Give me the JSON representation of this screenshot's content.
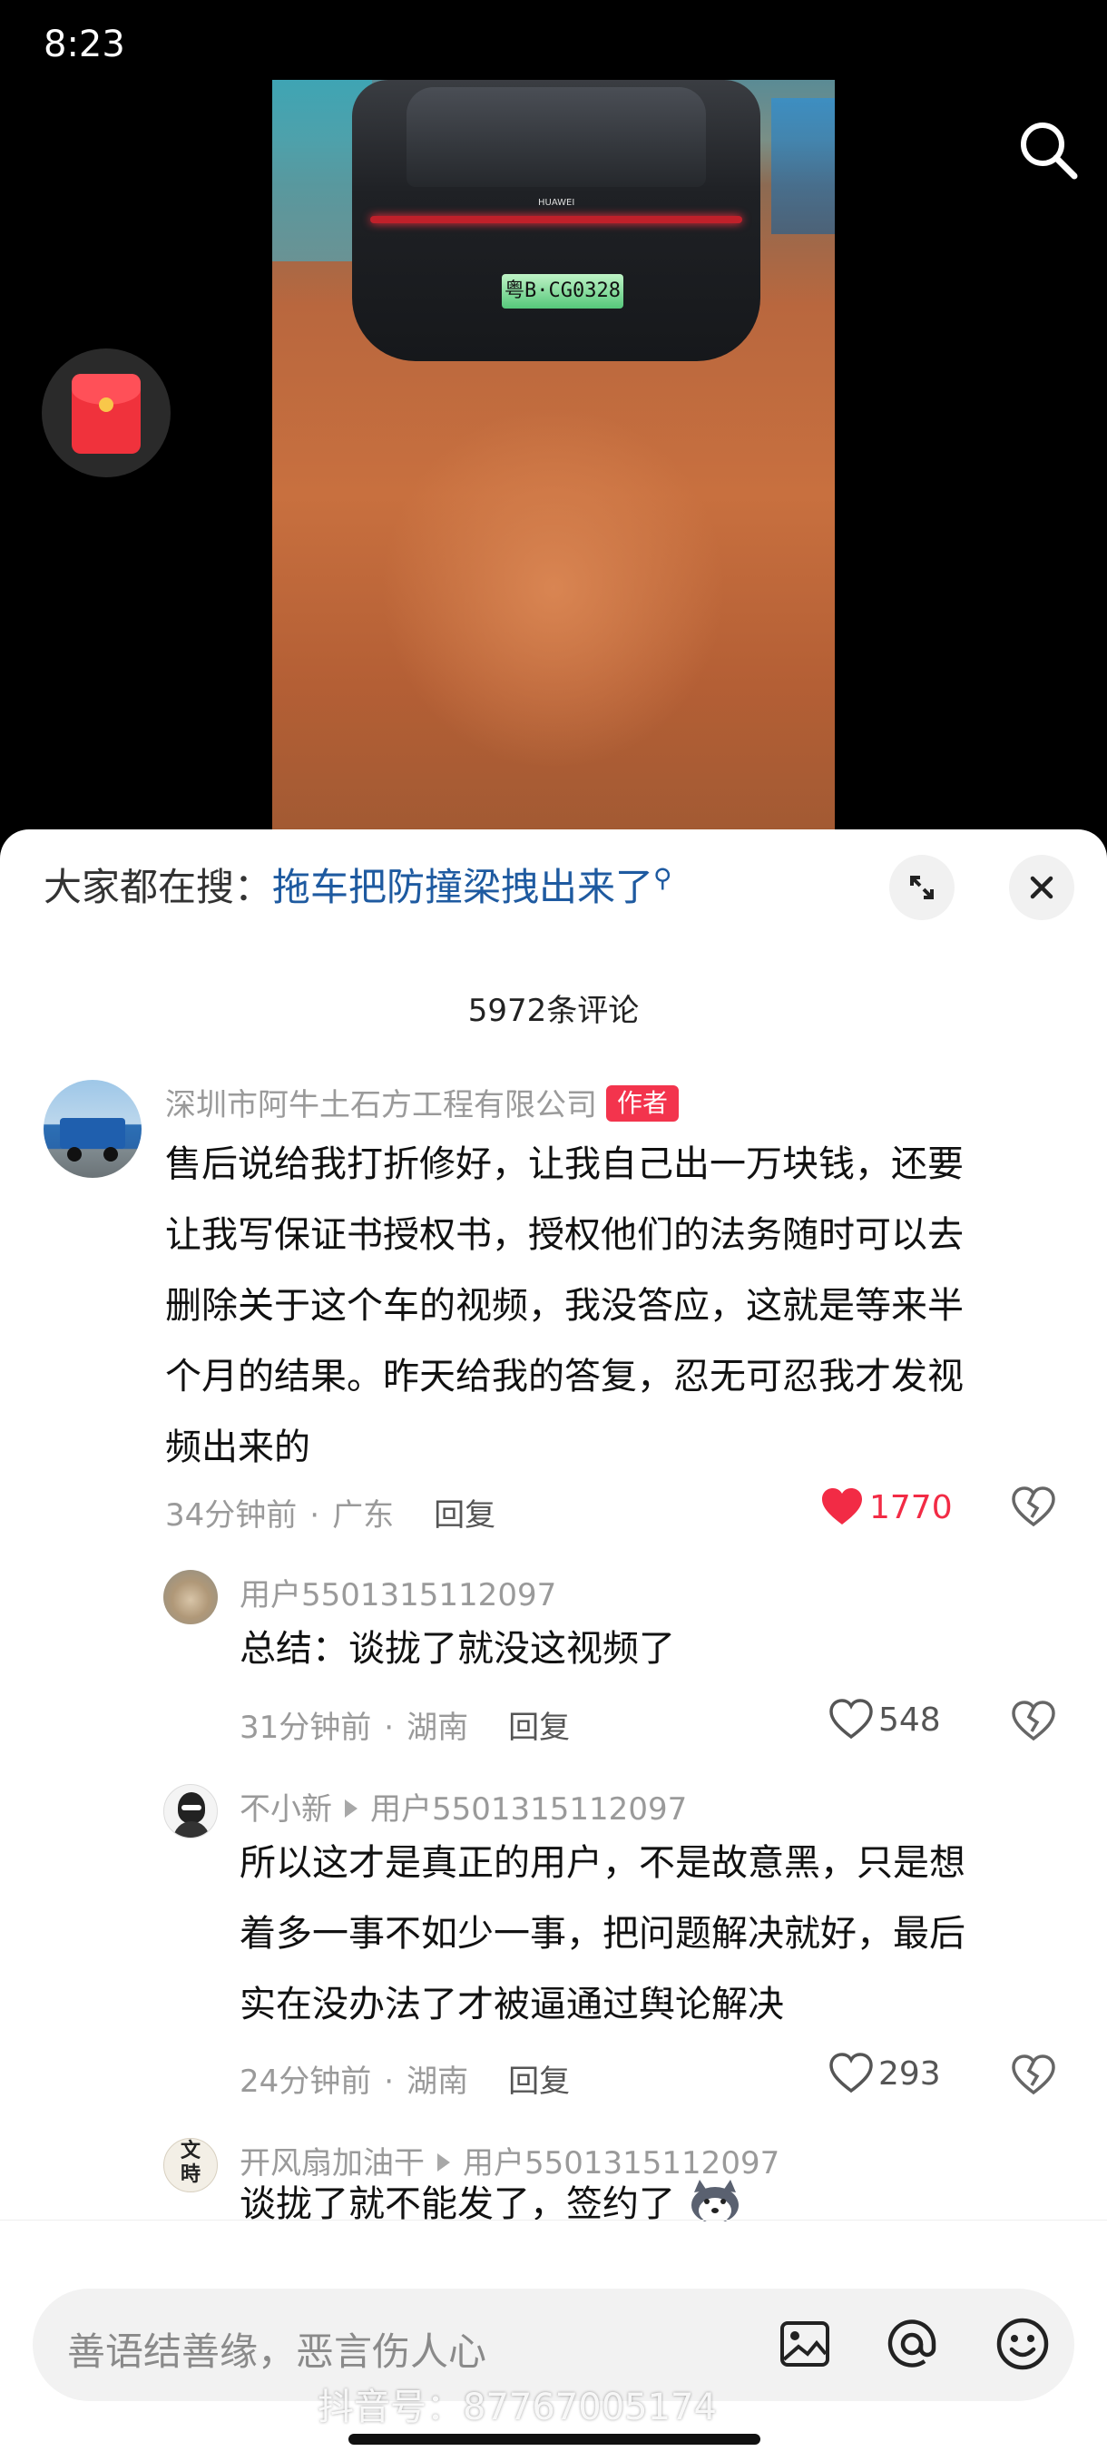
{
  "status_bar": {
    "time": "8:23"
  },
  "video": {
    "plate_text": "粤B·CG0328",
    "car_brand": "HUAWEI"
  },
  "sheet": {
    "hot_search_prefix": "大家都在搜：",
    "hot_search_link": "拖车把防撞梁拽出来了",
    "comment_count": "5972条评论"
  },
  "comments": [
    {
      "author": "深圳市阿牛土石方工程有限公司",
      "author_tag": "作者",
      "lines": [
        "售后说给我打折修好，让我自己出一万块钱，还要",
        "让我写保证书授权书，授权他们的法务随时可以去",
        "删除关于这个车的视频，我没答应，这就是等来半",
        "个月的结果。昨天给我的答复，忍无可忍我才发视",
        "频出来的"
      ],
      "time": "34分钟前",
      "location": "广东",
      "reply_label": "回复",
      "likes": "1770",
      "liked": true
    },
    {
      "author": "用户5501315112097",
      "lines": [
        "总结：谈拢了就没这视频了"
      ],
      "time": "31分钟前",
      "location": "湖南",
      "reply_label": "回复",
      "likes": "548"
    },
    {
      "author": "不小新",
      "reply_to": "用户5501315112097",
      "lines": [
        "所以这才是真正的用户，不是故意黑，只是想",
        "着多一事不如少一事，把问题解决就好，最后",
        "实在没办法了才被逼通过舆论解决"
      ],
      "time": "24分钟前",
      "location": "湖南",
      "reply_label": "回复",
      "likes": "293"
    },
    {
      "author": "开风扇加油干",
      "reply_to": "用户5501315112097",
      "avatar_text": [
        "文",
        "時"
      ],
      "lines": [
        "谈拢了就不能发了，签约了"
      ]
    }
  ],
  "input_bar": {
    "placeholder": "善语结善缘，恶言伤人心"
  },
  "watermark": "抖音号：87767005174",
  "colors": {
    "like_red": "#f22b45",
    "link_blue": "#1e5aa0",
    "author_tag": "#f3344d"
  },
  "icons": [
    "search-icon",
    "red-packet-icon",
    "expand-icon",
    "close-icon",
    "heart-icon",
    "broken-heart-icon",
    "image-icon",
    "at-icon",
    "emoji-icon"
  ]
}
